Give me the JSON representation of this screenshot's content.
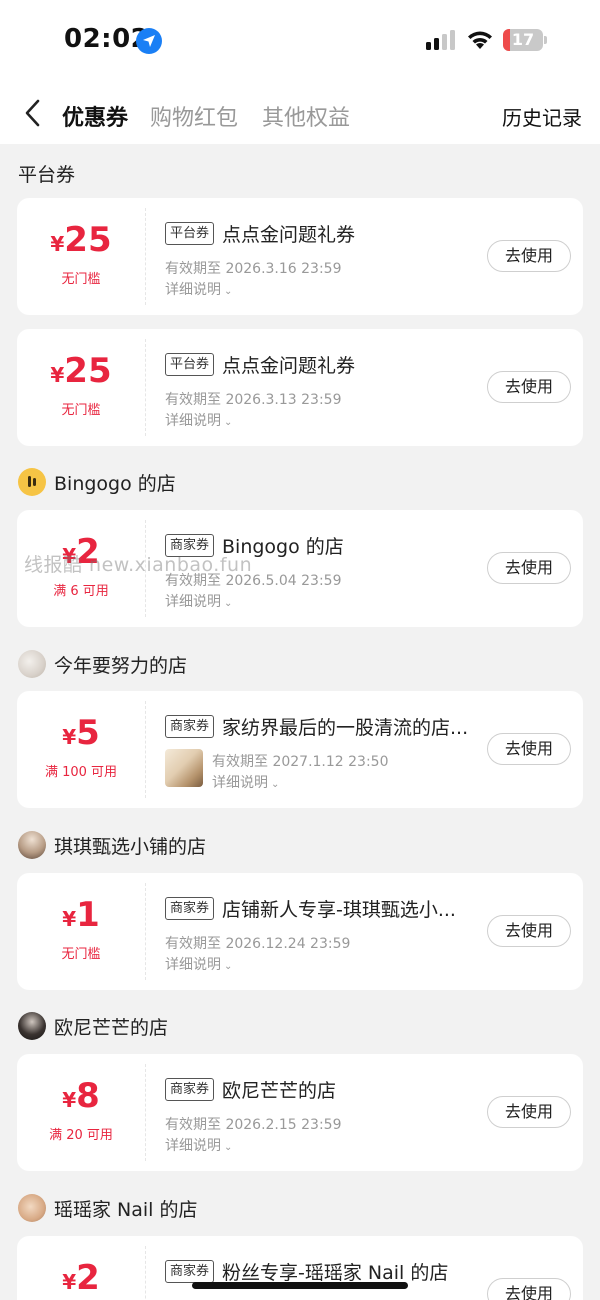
{
  "status_bar": {
    "time": "02:02",
    "battery_level": "17",
    "battery_fraction": 0.17,
    "icons": [
      "location-arrow-icon",
      "signal-icon",
      "wifi-icon",
      "battery-icon"
    ],
    "battery_color": "#ee4b4b"
  },
  "nav": {
    "tabs": [
      {
        "label": "优惠券",
        "active": true
      },
      {
        "label": "购物红包",
        "active": false
      },
      {
        "label": "其他权益",
        "active": false
      }
    ],
    "history_label": "历史记录"
  },
  "sections": {
    "platform": "平台券",
    "shop1": "Bingogo 的店",
    "shop2": "今年要努力的店",
    "shop3": "琪琪甄选小铺的店",
    "shop4": "欧尼芒芒的店",
    "shop5": "瑶瑶家 Nail 的店"
  },
  "yen_symbol": "¥",
  "use_label": "去使用",
  "details_label": "详细说明",
  "watermark": "线报酷 new.xianbao.fun",
  "accent_color": "#e8253f",
  "coupons": [
    {
      "amount": "25",
      "condition": "无门槛",
      "tag": "平台券",
      "title": "点点金问题礼券",
      "expiry": "有效期至 2026.3.16 23:59"
    },
    {
      "amount": "25",
      "condition": "无门槛",
      "tag": "平台券",
      "title": "点点金问题礼券",
      "expiry": "有效期至 2026.3.13 23:59"
    },
    {
      "amount": "2",
      "condition": "满 6 可用",
      "tag": "商家券",
      "title": "Bingogo 的店",
      "expiry": "有效期至 2026.5.04 23:59"
    },
    {
      "amount": "5",
      "condition": "满 100 可用",
      "tag": "商家券",
      "title": "家纺界最后的一股清流的店...",
      "expiry": "有效期至 2027.1.12 23:50"
    },
    {
      "amount": "1",
      "condition": "无门槛",
      "tag": "商家券",
      "title": "店铺新人专享-琪琪甄选小...",
      "expiry": "有效期至 2026.12.24 23:59"
    },
    {
      "amount": "8",
      "condition": "满 20 可用",
      "tag": "商家券",
      "title": "欧尼芒芒的店",
      "expiry": "有效期至 2026.2.15 23:59"
    },
    {
      "amount": "2",
      "condition": "",
      "tag": "商家券",
      "title": "粉丝专享-瑶瑶家 Nail 的店",
      "expiry": ""
    }
  ]
}
